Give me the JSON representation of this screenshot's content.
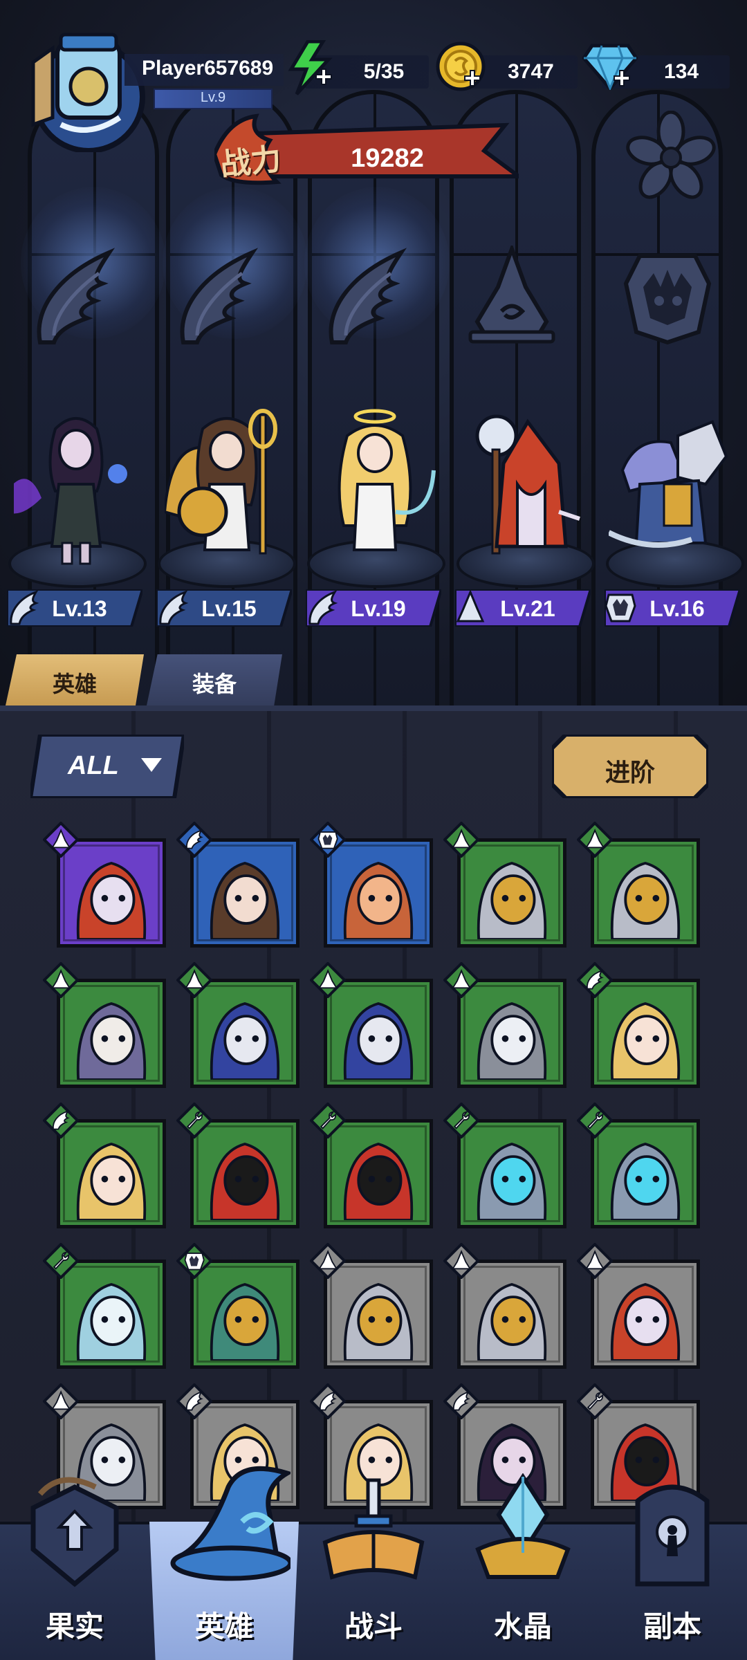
{
  "player": {
    "name": "Player657689",
    "level": "Lv.9"
  },
  "resources": {
    "energy": "5/35",
    "gold": "3747",
    "diamonds": "134"
  },
  "power": {
    "label": "战力",
    "value": "19282"
  },
  "lineup": [
    {
      "level": "Lv.13",
      "class_icon": "wing-icon",
      "badge_color": "#3a5a9a"
    },
    {
      "level": "Lv.15",
      "class_icon": "wing-icon",
      "badge_color": "#3a5a9a"
    },
    {
      "level": "Lv.19",
      "class_icon": "wing-icon",
      "badge_color": "#5a3cc0"
    },
    {
      "level": "Lv.21",
      "class_icon": "wizard-hat-icon",
      "badge_color": "#5a3cc0"
    },
    {
      "level": "Lv.16",
      "class_icon": "beast-icon",
      "badge_color": "#5a3cc0"
    }
  ],
  "tabs": {
    "heroes": "英雄",
    "equipment": "装备"
  },
  "filter": {
    "label": "ALL"
  },
  "advance": {
    "label": "进阶"
  },
  "roster": [
    {
      "rarity": "purple",
      "class_icon": "wizard-hat-icon",
      "portrait": "red-hooded-mage"
    },
    {
      "rarity": "blue",
      "class_icon": "wing-icon",
      "portrait": "laurel-goddess"
    },
    {
      "rarity": "blue",
      "class_icon": "beast-icon",
      "portrait": "fox-beast"
    },
    {
      "rarity": "green",
      "class_icon": "wizard-hat-icon",
      "portrait": "knight-helmet"
    },
    {
      "rarity": "green",
      "class_icon": "wizard-hat-icon",
      "portrait": "knight-helmet"
    },
    {
      "rarity": "green",
      "class_icon": "wizard-hat-icon",
      "portrait": "bandaged-nun"
    },
    {
      "rarity": "green",
      "class_icon": "wizard-hat-icon",
      "portrait": "monocle-wizard"
    },
    {
      "rarity": "green",
      "class_icon": "wizard-hat-icon",
      "portrait": "monocle-wizard"
    },
    {
      "rarity": "green",
      "class_icon": "wizard-hat-icon",
      "portrait": "old-sage"
    },
    {
      "rarity": "green",
      "class_icon": "wing-icon",
      "portrait": "blonde-priestess"
    },
    {
      "rarity": "green",
      "class_icon": "wing-icon",
      "portrait": "blonde-priestess"
    },
    {
      "rarity": "green",
      "class_icon": "wrench-icon",
      "portrait": "red-robot"
    },
    {
      "rarity": "green",
      "class_icon": "wrench-icon",
      "portrait": "red-robot"
    },
    {
      "rarity": "green",
      "class_icon": "wrench-icon",
      "portrait": "cyan-mech"
    },
    {
      "rarity": "green",
      "class_icon": "wrench-icon",
      "portrait": "cyan-mech"
    },
    {
      "rarity": "green",
      "class_icon": "wrench-icon",
      "portrait": "ghost-diver"
    },
    {
      "rarity": "green",
      "class_icon": "beast-icon",
      "portrait": "elf-queen"
    },
    {
      "rarity": "grey",
      "class_icon": "wizard-hat-icon",
      "portrait": "knight-helmet"
    },
    {
      "rarity": "grey",
      "class_icon": "wizard-hat-icon",
      "portrait": "knight-helmet"
    },
    {
      "rarity": "grey",
      "class_icon": "wizard-hat-icon",
      "portrait": "red-hooded-mage"
    },
    {
      "rarity": "grey",
      "class_icon": "wizard-hat-icon",
      "portrait": "old-sage"
    },
    {
      "rarity": "grey",
      "class_icon": "wing-icon",
      "portrait": "blonde-priestess"
    },
    {
      "rarity": "grey",
      "class_icon": "wing-icon",
      "portrait": "blonde-priestess"
    },
    {
      "rarity": "grey",
      "class_icon": "wing-icon",
      "portrait": "dark-sorceress"
    },
    {
      "rarity": "grey",
      "class_icon": "wrench-icon",
      "portrait": "red-robot"
    }
  ],
  "nav": [
    {
      "label": "果实",
      "icon": "keyhole-shield-icon"
    },
    {
      "label": "英雄",
      "icon": "wizard-hat-icon",
      "active": true
    },
    {
      "label": "战斗",
      "icon": "sword-book-icon"
    },
    {
      "label": "水晶",
      "icon": "crystal-icon"
    },
    {
      "label": "副本",
      "icon": "keyhole-door-icon"
    }
  ],
  "colors": {
    "rarity_purple": "#6b3fc8",
    "rarity_blue": "#2f63b8",
    "rarity_green": "#3d8a3f",
    "rarity_grey": "#8a8a8a",
    "power_banner": "#b23a2a",
    "advance_button": "#d8b06a",
    "nav_active": "#9fb6ea"
  }
}
